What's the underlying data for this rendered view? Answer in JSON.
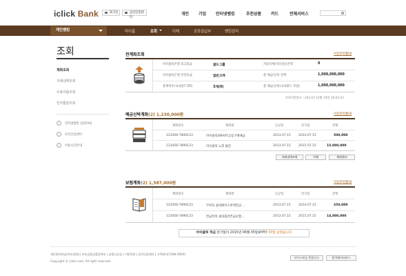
{
  "brand": {
    "part1": "iclick",
    "part2": " Bank"
  },
  "top_buttons": [
    "로그인",
    "공인인증센터"
  ],
  "top_nav": [
    "개인",
    "기업",
    "인터넷뱅킹",
    "추천상품",
    "카드",
    "전체서비스"
  ],
  "menu": {
    "dropdown": "개인뱅킹",
    "items": [
      "마이홈",
      "조회",
      "이체",
      "공과금납부",
      "뱅킹관리"
    ],
    "active_index": 1
  },
  "sidebar": {
    "title": "조회",
    "items": [
      "계좌조회",
      "거래내역조회",
      "수표어음조회",
      "전자통장조회"
    ],
    "active_index": 0,
    "links": [
      "인터넷뱅킹 상담FAQ",
      "보안인증센터",
      "이용시간안내"
    ]
  },
  "all_accounts": {
    "title": "전계좌조회",
    "links": [
      "마일로착정",
      "인쇄"
    ],
    "rows": [
      {
        "l1": "아이클릭은행 최고등급",
        "v1": "골드그룹",
        "l2": "자동이체/이터넷신잔액",
        "v2": "0"
      },
      {
        "l1": "아이클릭은행 분한등급",
        "v1": "일반고객",
        "l2": "총 예금/신탁 잔액",
        "v2": "1,000,000,000"
      },
      {
        "l1": "총계좌수(국내원드계좌",
        "v1": "3개(0)",
        "l2": "총 예금/신탁(국내원드 포함)",
        "v2": "1,000,000,000"
      }
    ],
    "timestamp": "조회기준일시 : 2013년 12월 19일 16:03:15"
  },
  "deposit": {
    "title": "예금신탁계좌",
    "count": "(2)",
    "amount": "1,230,000원",
    "links": [
      "마일로착정",
      "인쇄"
    ],
    "headers": [
      "계좌번호",
      "계좌명",
      "신규일",
      "만기일",
      "잔액"
    ],
    "rows": [
      [
        "123456-7890123",
        "아이클릭SMART공동구매예금",
        "2013.07.15",
        "2014.07.15",
        "500,000"
      ],
      [
        "123456-7890123",
        "아이클릭 노후 통장",
        "2013.07.15",
        "2015.07.15",
        "15,000,000"
      ]
    ],
    "buttons": [
      "거래내역조회",
      "이체",
      "계좌관리"
    ]
  },
  "insurance": {
    "title": "보험계좌",
    "count": "(2)",
    "amount": "1,587,000원",
    "links": [
      "마일로착정",
      "인쇄"
    ],
    "headers": [
      "계좌번호",
      "계좌명",
      "신규일",
      "만기일",
      "잔액"
    ],
    "rows": [
      [
        "123456-7890123",
        "부쉬덧 클릭배이스변액연금 ...",
        "2013.07.15",
        "2014.07.15",
        "250,000"
      ],
      [
        "123456-7890123",
        "연금저축 클릭플한연금보험...",
        "2013.07.15",
        "2015.07.15",
        "14,800,000"
      ]
    ]
  },
  "notice": {
    "bold": "아이클릭 적금",
    "text": " 만기일이 2015년 06월 05일로부터 ",
    "highlight": "03일 남았습니다"
  },
  "footer": {
    "links": "개인정보취급(처리)방침 | 보호금융상품등록부 | 상품시공실 | 이용약관 | 공인인증센터 | 고객센터(1588-0000)",
    "copyright": "Copyright © iclick.com, All right reserved.",
    "buttons": [
      "보이스피싱 민원신고",
      "원격제어서비스"
    ]
  }
}
